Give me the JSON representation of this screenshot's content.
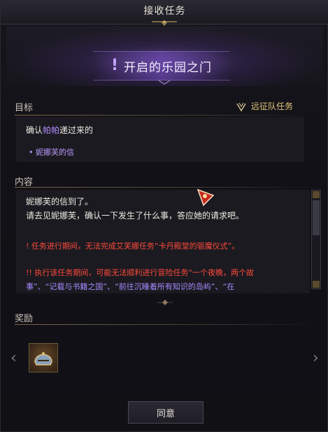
{
  "window": {
    "title": "接收任务"
  },
  "quest": {
    "title": "开启的乐园之门",
    "icon": "exclamation-icon"
  },
  "objective": {
    "label": "目标",
    "type_label": "远征队任务",
    "line1_prefix": "确认",
    "line1_highlight": "帕帕",
    "line1_suffix": "递过来的",
    "bullet": "• 妮娜芙的信"
  },
  "content": {
    "label": "内容",
    "lines": [
      "妮娜芙的信到了。",
      "请去见妮娜芙，确认一下发生了什么事，答应她的请求吧。",
      "! 任务进行期间，无法完成艾芙娜任务“卡丹殿堂的驱魔仪式”。",
      "!! 执行该任务期间，可能无法顺利进行冒险任务“一个夜晚，两个故",
      "事”、“记载与书籍之国”、“前往沉睡着所有知识的岛屿”、“在"
    ]
  },
  "rewards": {
    "label": "奖励",
    "item_icon": "helmet-icon"
  },
  "buttons": {
    "accept": "同意"
  },
  "colors": {
    "accent_purple": "#b48cff",
    "warning_red": "#ff4a3c",
    "gold": "#e3c77a"
  }
}
